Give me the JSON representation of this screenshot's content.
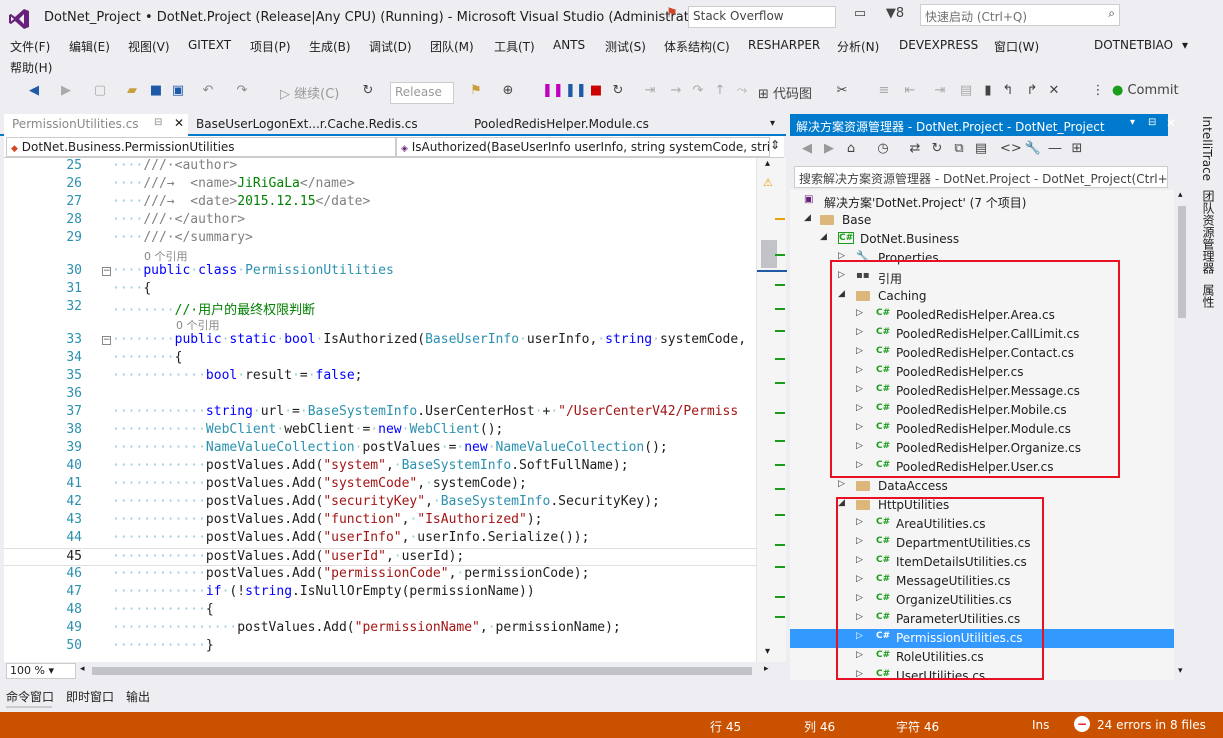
{
  "window": {
    "title": "DotNet_Project • DotNet.Project (Release|Any CPU) (Running) - Microsoft Visual Studio (Administrator)",
    "search_box": "Stack Overflow",
    "notification_count": "8",
    "quick_launch_placeholder": "快速启动 (Ctrl+Q)"
  },
  "menu": {
    "items": [
      "文件(F)",
      "编辑(E)",
      "视图(V)",
      "GITEXT",
      "项目(P)",
      "生成(B)",
      "调试(D)",
      "团队(M)",
      "工具(T)",
      "ANTS",
      "测试(S)",
      "体系结构(C)",
      "RESHARPER",
      "分析(N)",
      "DEVEXPRESS",
      "窗口(W)",
      "DOTNETBIAO"
    ],
    "help": "帮助(H)"
  },
  "toolbar": {
    "continue_label": "继续(C)",
    "config_value": "Release",
    "code_map_label": "代码图",
    "commit_label": "Commit"
  },
  "tabs": [
    {
      "label": "PermissionUtilities.cs"
    },
    {
      "label": "BaseUserLogonExt...r.Cache.Redis.cs"
    },
    {
      "label": "PooledRedisHelper.Module.cs"
    }
  ],
  "nav": {
    "class_combo": "DotNet.Business.PermissionUtilities",
    "member_combo": "IsAuthorized(BaseUserInfo userInfo, string systemCode, strir"
  },
  "editor": {
    "zoom": "100 %",
    "ref_hint_class": "0 个引用",
    "ref_hint_method": "0 个引用",
    "line_numbers": [
      "25",
      "26",
      "27",
      "28",
      "29",
      "30",
      "31",
      "32",
      "33",
      "34",
      "35",
      "36",
      "37",
      "38",
      "39",
      "40",
      "41",
      "42",
      "43",
      "44",
      "45",
      "46",
      "47",
      "48",
      "49",
      "50"
    ]
  },
  "solution_explorer": {
    "title": "解决方案资源管理器 - DotNet.Project - DotNet_Project",
    "search_placeholder": "搜索解决方案资源管理器 - DotNet.Project - DotNet_Project(Ctrl+",
    "solution_label": "解决方案'DotNet.Project' (7 个项目)",
    "base_folder": "Base",
    "project": "DotNet.Business",
    "properties": "Properties",
    "references": "引用",
    "caching_folder": "Caching",
    "caching_files": [
      "PooledRedisHelper.Area.cs",
      "PooledRedisHelper.CallLimit.cs",
      "PooledRedisHelper.Contact.cs",
      "PooledRedisHelper.cs",
      "PooledRedisHelper.Message.cs",
      "PooledRedisHelper.Mobile.cs",
      "PooledRedisHelper.Module.cs",
      "PooledRedisHelper.Organize.cs",
      "PooledRedisHelper.User.cs"
    ],
    "dataaccess_folder": "DataAccess",
    "httputilities_folder": "HttpUtilities",
    "http_files": [
      "AreaUtilities.cs",
      "DepartmentUtilities.cs",
      "ItemDetailsUtilities.cs",
      "MessageUtilities.cs",
      "OrganizeUtilities.cs",
      "ParameterUtilities.cs",
      "PermissionUtilities.cs",
      "RoleUtilities.cs",
      "UserUtilities.cs"
    ]
  },
  "right_tabs": [
    "IntelliTrace",
    "团队资源管理器",
    "属性"
  ],
  "bottom_tabs": [
    "命令窗口",
    "即时窗口",
    "输出"
  ],
  "status": {
    "line": "行 45",
    "col": "列 46",
    "char": "字符 46",
    "mode": "Ins",
    "errors": "24 errors in 8 files"
  },
  "colors": {
    "accent": "#007acc",
    "status_bar": "#ca5100",
    "selection": "#3399ff",
    "red_box": "#e81123"
  }
}
